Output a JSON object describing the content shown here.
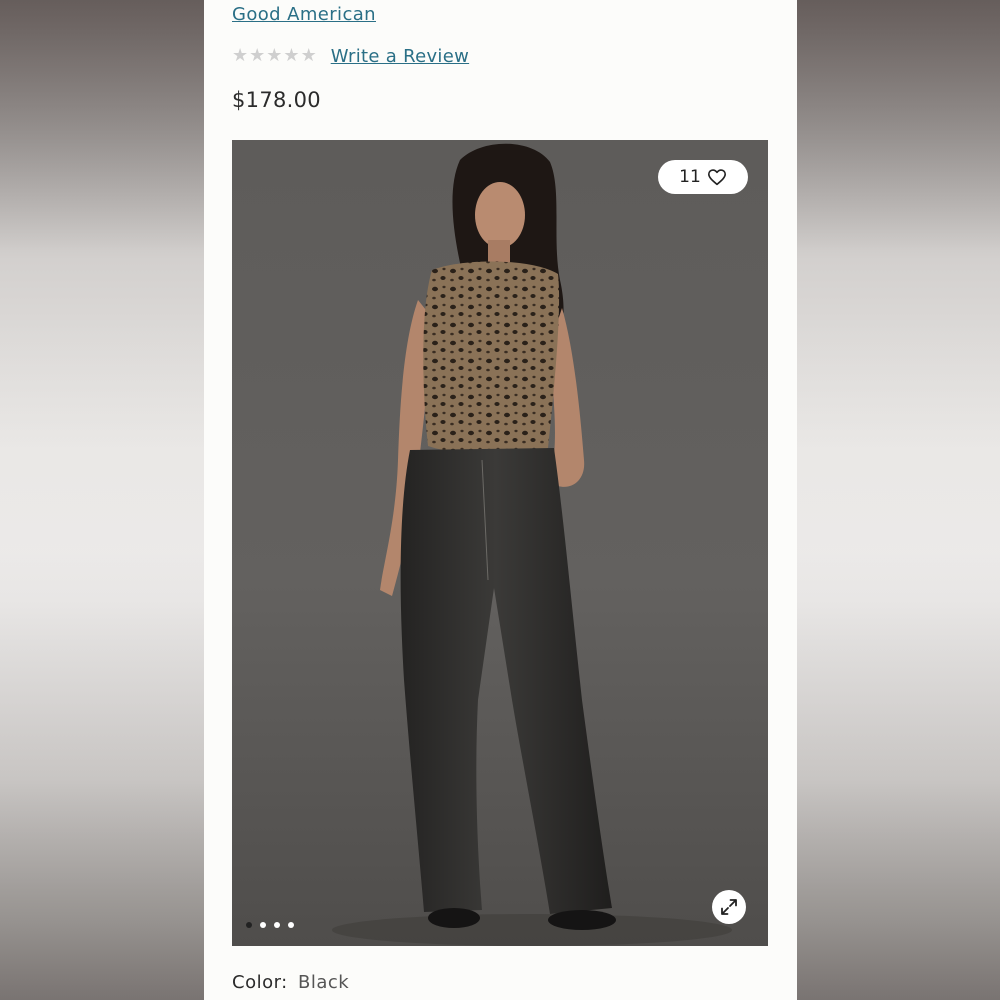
{
  "product": {
    "brand": "Good American",
    "rating_stars": 5,
    "rating_value": 0,
    "review_link": "Write a Review",
    "price": "$178.00",
    "likes": "11",
    "color_label": "Color:",
    "color_value": "Black"
  },
  "gallery": {
    "image_count": 4,
    "active_index": 0,
    "expand_icon": "expand-icon",
    "like_icon": "heart-icon"
  },
  "colors": {
    "link": "#2a6f86",
    "star_empty": "#cfcfcf"
  }
}
